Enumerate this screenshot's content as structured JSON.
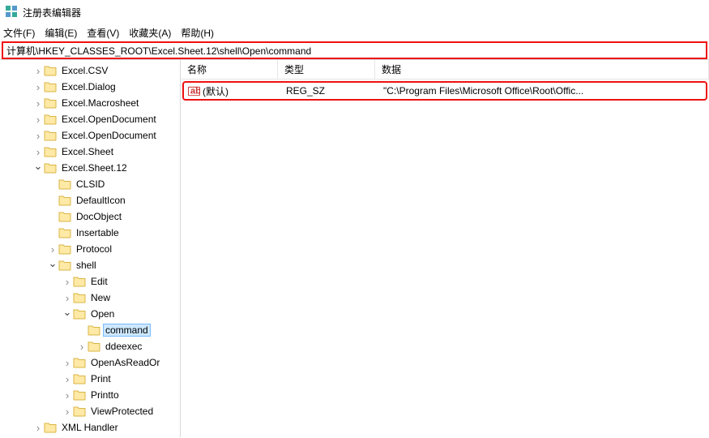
{
  "window": {
    "title": "注册表编辑器"
  },
  "menu": {
    "file": "文件(F)",
    "edit": "编辑(E)",
    "view": "查看(V)",
    "favorites": "收藏夹(A)",
    "help": "帮助(H)"
  },
  "address": {
    "path": "计算机\\HKEY_CLASSES_ROOT\\Excel.Sheet.12\\shell\\Open\\command"
  },
  "columns": {
    "name": "名称",
    "type": "类型",
    "data": "数据"
  },
  "value": {
    "name": "(默认)",
    "type": "REG_SZ",
    "data": "\"C:\\Program Files\\Microsoft Office\\Root\\Offic..."
  },
  "tree": {
    "n0": "Excel.CSV",
    "n1": "Excel.Dialog",
    "n2": "Excel.Macrosheet",
    "n3": "Excel.OpenDocument",
    "n4": "Excel.OpenDocument",
    "n5": "Excel.Sheet",
    "n6": "Excel.Sheet.12",
    "n6_0": "CLSID",
    "n6_1": "DefaultIcon",
    "n6_2": "DocObject",
    "n6_3": "Insertable",
    "n6_4": "Protocol",
    "n6_5": "shell",
    "n6_5_0": "Edit",
    "n6_5_1": "New",
    "n6_5_2": "Open",
    "n6_5_2_0": "command",
    "n6_5_2_1": "ddeexec",
    "n6_5_3": "OpenAsReadOr",
    "n6_5_4": "Print",
    "n6_5_5": "Printto",
    "n6_5_6": "ViewProtected",
    "n7": "XML Handler"
  }
}
